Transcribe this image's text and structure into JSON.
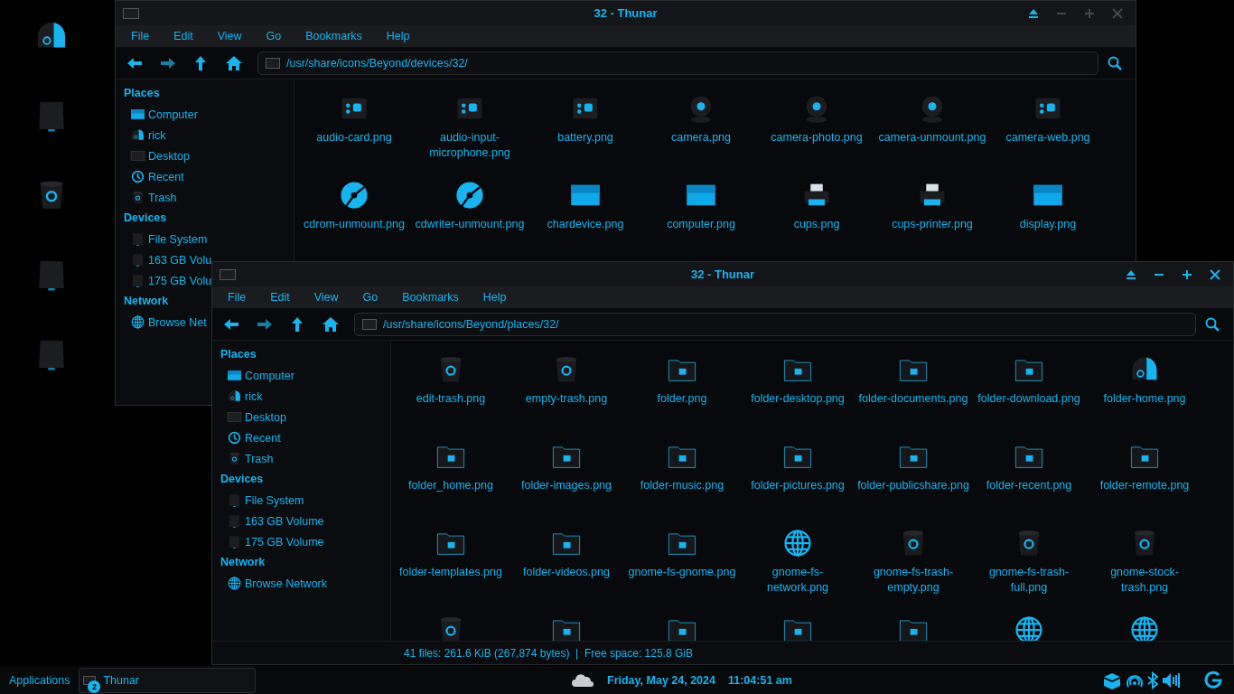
{
  "desktop_icons": [
    {
      "kind": "user"
    },
    {
      "kind": "drive"
    },
    {
      "kind": "trash"
    },
    {
      "kind": "drive"
    },
    {
      "kind": "drive"
    }
  ],
  "windows": [
    {
      "title": "32 - Thunar",
      "active": false,
      "menu": [
        "File",
        "Edit",
        "View",
        "Go",
        "Bookmarks",
        "Help"
      ],
      "back_disabled": false,
      "forward_disabled": true,
      "path": "/usr/share/icons/Beyond/devices/32/",
      "sidebar": [
        {
          "title": "Places",
          "items": [
            {
              "label": "Computer",
              "kind": "screen"
            },
            {
              "label": "rick",
              "kind": "user"
            },
            {
              "label": "Desktop",
              "kind": "desk"
            },
            {
              "label": "Recent",
              "kind": "clock"
            },
            {
              "label": "Trash",
              "kind": "trash"
            }
          ]
        },
        {
          "title": "Devices",
          "items": [
            {
              "label": "File System",
              "kind": "drive"
            },
            {
              "label": "163 GB Volu",
              "kind": "drive"
            },
            {
              "label": "175 GB Volu",
              "kind": "drive"
            }
          ]
        },
        {
          "title": "Network",
          "items": [
            {
              "label": "Browse Net",
              "kind": "globe"
            }
          ]
        }
      ],
      "files": [
        {
          "name": "audio-card.png",
          "kind": "device"
        },
        {
          "name": "audio-input-microphone.png",
          "kind": "device"
        },
        {
          "name": "battery.png",
          "kind": "device"
        },
        {
          "name": "camera.png",
          "kind": "camera"
        },
        {
          "name": "camera-photo.png",
          "kind": "camera"
        },
        {
          "name": "camera-unmount.png",
          "kind": "camera"
        },
        {
          "name": "camera-web.png",
          "kind": "device"
        },
        {
          "name": "cdrom-unmount.png",
          "kind": "disc"
        },
        {
          "name": "cdwriter-unmount.png",
          "kind": "disc"
        },
        {
          "name": "chardevice.png",
          "kind": "screen"
        },
        {
          "name": "computer.png",
          "kind": "screen"
        },
        {
          "name": "cups.png",
          "kind": "printer"
        },
        {
          "name": "cups-printer.png",
          "kind": "printer"
        },
        {
          "name": "display.png",
          "kind": "screen"
        }
      ]
    },
    {
      "title": "32 - Thunar",
      "active": true,
      "menu": [
        "File",
        "Edit",
        "View",
        "Go",
        "Bookmarks",
        "Help"
      ],
      "back_disabled": false,
      "forward_disabled": true,
      "path": "/usr/share/icons/Beyond/places/32/",
      "sidebar": [
        {
          "title": "Places",
          "items": [
            {
              "label": "Computer",
              "kind": "screen"
            },
            {
              "label": "rick",
              "kind": "user"
            },
            {
              "label": "Desktop",
              "kind": "desk"
            },
            {
              "label": "Recent",
              "kind": "clock"
            },
            {
              "label": "Trash",
              "kind": "trash"
            }
          ]
        },
        {
          "title": "Devices",
          "items": [
            {
              "label": "File System",
              "kind": "drive"
            },
            {
              "label": "163 GB Volume",
              "kind": "drive"
            },
            {
              "label": "175 GB Volume",
              "kind": "drive"
            }
          ]
        },
        {
          "title": "Network",
          "items": [
            {
              "label": "Browse Network",
              "kind": "globe"
            }
          ]
        }
      ],
      "files": [
        {
          "name": "edit-trash.png",
          "kind": "trash"
        },
        {
          "name": "empty-trash.png",
          "kind": "trash"
        },
        {
          "name": "folder.png",
          "kind": "folder"
        },
        {
          "name": "folder-desktop.png",
          "kind": "folder"
        },
        {
          "name": "folder-documents.png",
          "kind": "folder"
        },
        {
          "name": "folder-download.png",
          "kind": "folder"
        },
        {
          "name": "folder-home.png",
          "kind": "user"
        },
        {
          "name": "folder_home.png",
          "kind": "folder"
        },
        {
          "name": "folder-images.png",
          "kind": "folder"
        },
        {
          "name": "folder-music.png",
          "kind": "folder"
        },
        {
          "name": "folder-pictures.png",
          "kind": "folder"
        },
        {
          "name": "folder-publicshare.png",
          "kind": "folder"
        },
        {
          "name": "folder-recent.png",
          "kind": "folder"
        },
        {
          "name": "folder-remote.png",
          "kind": "folder"
        },
        {
          "name": "folder-templates.png",
          "kind": "folder"
        },
        {
          "name": "folder-videos.png",
          "kind": "folder"
        },
        {
          "name": "gnome-fs-gnome.png",
          "kind": "folder"
        },
        {
          "name": "gnome-fs-network.png",
          "kind": "globe"
        },
        {
          "name": "gnome-fs-trash-empty.png",
          "kind": "trash"
        },
        {
          "name": "gnome-fs-trash-full.png",
          "kind": "trash"
        },
        {
          "name": "gnome-stock-trash.png",
          "kind": "trash"
        },
        {
          "kind": "trash"
        },
        {
          "kind": "folder"
        },
        {
          "kind": "folder"
        },
        {
          "kind": "folder"
        },
        {
          "kind": "folder"
        },
        {
          "kind": "globe"
        },
        {
          "kind": "globe"
        }
      ],
      "status": "41 files: 261.6 KiB (267,874 bytes)  |  Free space: 125.8 GiB"
    }
  ],
  "taskbar": {
    "menu": "Applications",
    "task": {
      "badge": "2",
      "label": "Thunar"
    },
    "date": "Friday, May 24, 2024",
    "time": "11:04:51 am"
  }
}
